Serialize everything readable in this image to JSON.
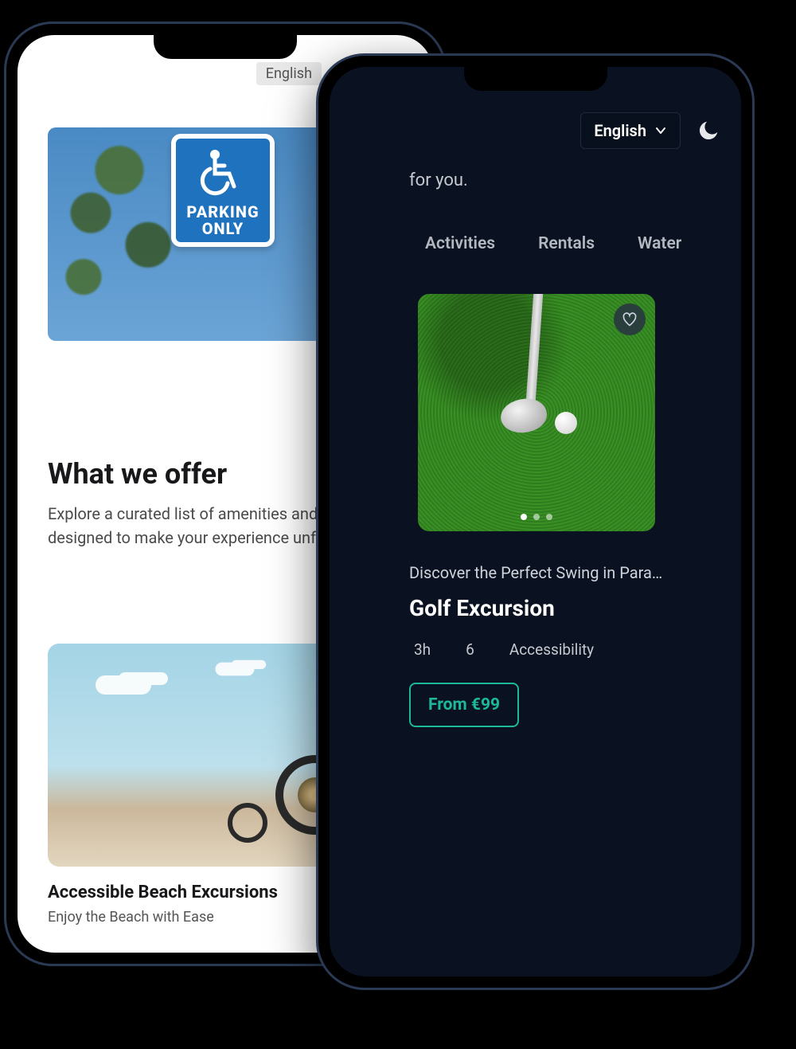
{
  "phone_a": {
    "language": "English",
    "hero_sign_line1": "PARKING",
    "hero_sign_line2": "ONLY",
    "offer": {
      "heading": "What we offer",
      "subheading": "Explore a curated list of amenities and services designed to make your experience unforgettable."
    },
    "card": {
      "title": "Accessible Beach Excursions",
      "subtitle": "Enjoy the Beach with Ease"
    }
  },
  "phone_b": {
    "language": "English",
    "tagline_fragment": "for you.",
    "tabs": [
      "Activities",
      "Rentals",
      "Water"
    ],
    "card": {
      "subtitle": "Discover the Perfect Swing in Para...",
      "title": "Golf Excursion",
      "meta": {
        "duration": "3h",
        "people": "6",
        "accessibility": "Accessibility"
      },
      "price": "From €99",
      "image_dots_total": 3,
      "image_dots_active": 1
    }
  }
}
